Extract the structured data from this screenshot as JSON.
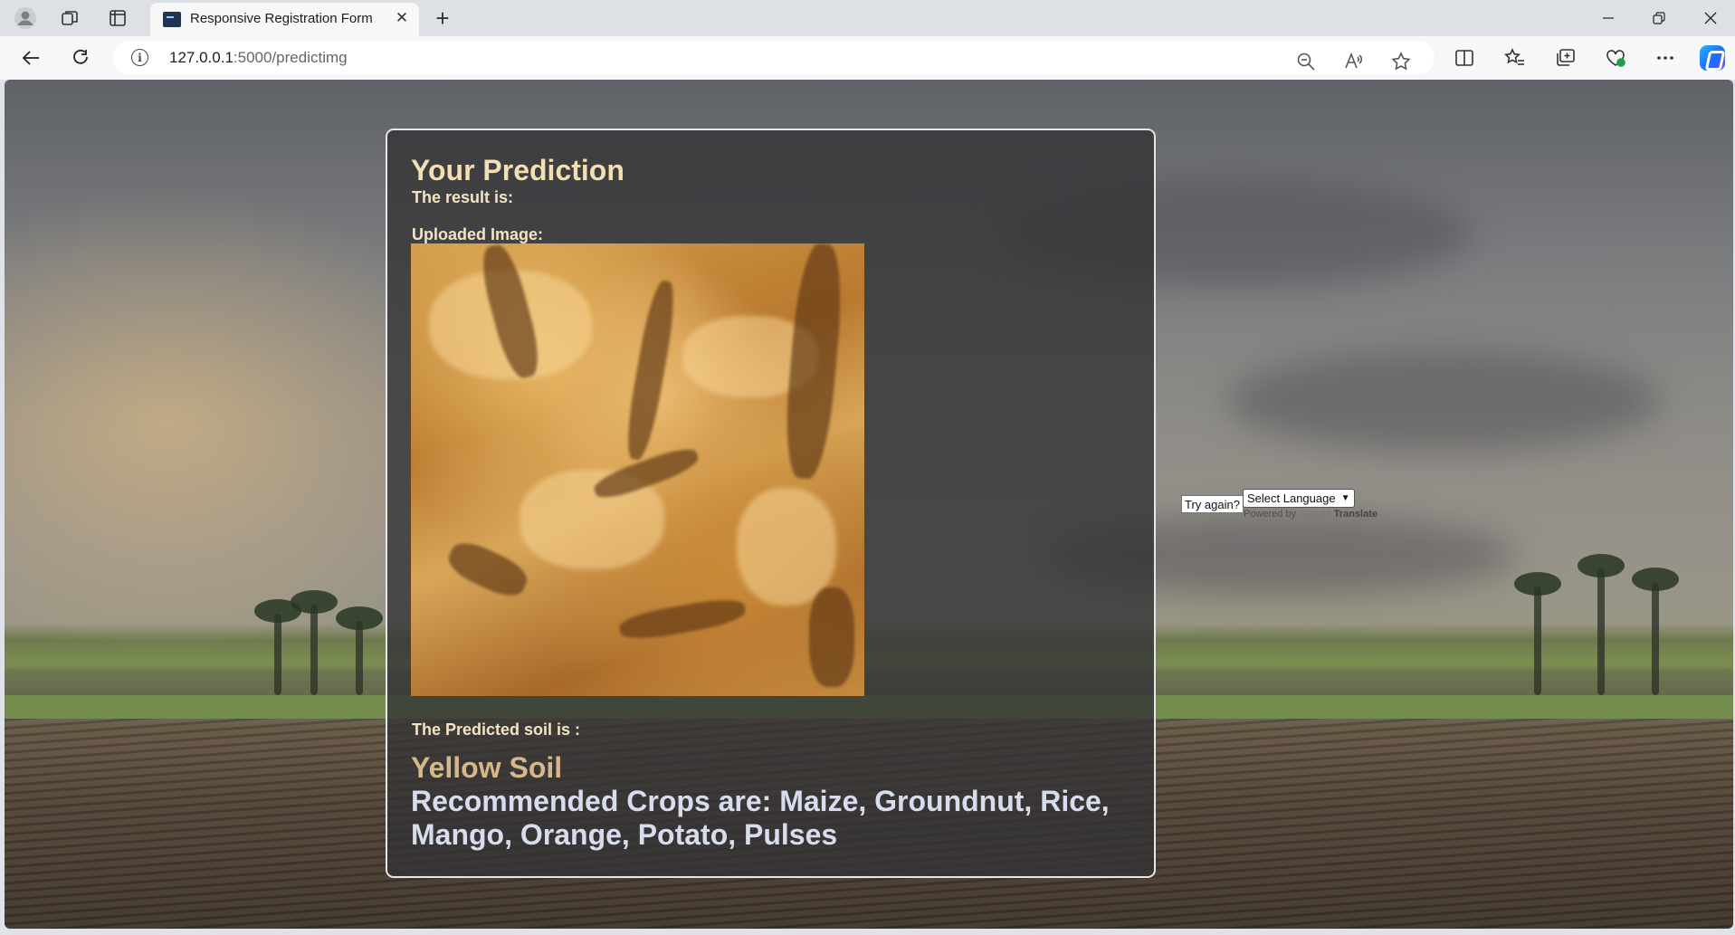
{
  "browser": {
    "tab_title": "Responsive Registration Form",
    "tab_close": "✕",
    "new_tab": "+",
    "url_host": "127.0.0.1",
    "url_path": ":5000/predictimg",
    "icons": [
      "profile-icon",
      "workspaces-icon",
      "tab-actions-icon",
      "back-icon",
      "refresh-icon",
      "site-info-icon",
      "zoom-out-icon",
      "read-aloud-icon",
      "favorite-star-icon",
      "split-screen-icon",
      "favorites-icon",
      "collections-icon",
      "browser-essentials-icon",
      "more-icon",
      "copilot-icon"
    ]
  },
  "card": {
    "title": "Your Prediction",
    "result_label": "The result is:",
    "uploaded_label": "Uploaded Image:",
    "predicted_label": "The Predicted soil is :",
    "soil_name": "Yellow Soil",
    "crops_text": "Recommended Crops are: Maize, Groundnut, Rice, Mango, Orange, Potato, Pulses"
  },
  "widgets": {
    "try_again": "Try again?",
    "language_select": "Select Language",
    "powered_by": "Powered by",
    "google": "Google",
    "translate": "Translate"
  },
  "colors": {
    "title": "#f4dfb4",
    "soil_name": "#d5b889",
    "crops": "#d8dcef"
  }
}
